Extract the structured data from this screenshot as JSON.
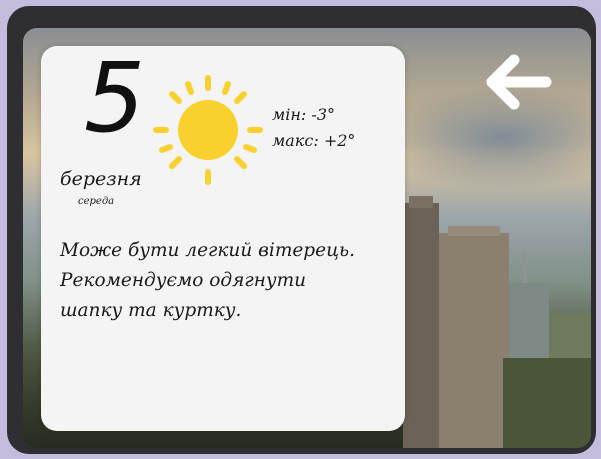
{
  "weather": {
    "day": "5",
    "month": "березня",
    "weekday": "середа",
    "min_label": "мін:",
    "min_value": "-3°",
    "max_label": "макс:",
    "max_value": "+2°",
    "condition_icon": "sun-icon",
    "advice_lines": [
      "Може бути легкий вітерець.",
      " Рекомендуємо одягнути",
      "шапку та куртку."
    ]
  },
  "navigation": {
    "back_icon": "arrow-left-icon"
  },
  "colors": {
    "sun": "#f8d12f",
    "card": "#f4f4f4",
    "frame": "#2e2e33",
    "page_background": "#c6bdde",
    "arrow": "#ffffff"
  }
}
